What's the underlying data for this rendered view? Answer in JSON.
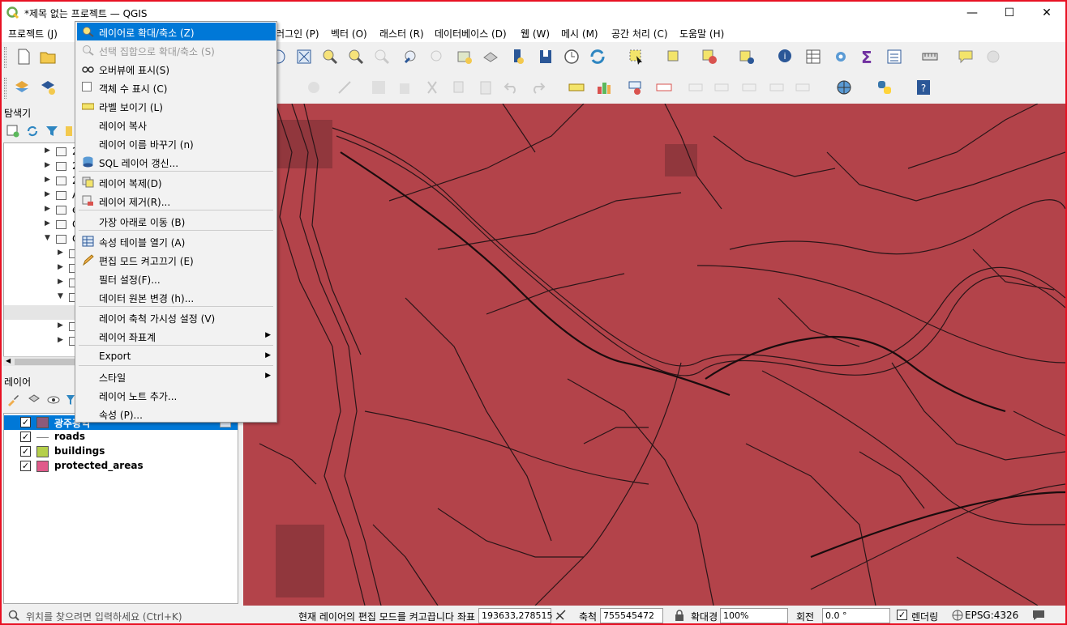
{
  "window": {
    "title": "*제목 없는 프로젝트 — QGIS",
    "minimize": "—",
    "maximize": "☐",
    "close": "✕"
  },
  "menubar": [
    {
      "label": "프로젝트 (J)"
    },
    {
      "label": "러그인 (P)"
    },
    {
      "label": "벡터 (O)"
    },
    {
      "label": "래스터 (R)"
    },
    {
      "label": "데이터베이스 (D)"
    },
    {
      "label": "웹 (W)"
    },
    {
      "label": "메시 (M)"
    },
    {
      "label": "공간 처리 (C)"
    },
    {
      "label": "도움말 (H)"
    }
  ],
  "browser_panel": {
    "title": "탐색기",
    "items": [
      {
        "label": "2"
      },
      {
        "label": "2"
      },
      {
        "label": "2"
      },
      {
        "label": "A"
      },
      {
        "label": "e"
      },
      {
        "label": "G"
      },
      {
        "label": "C"
      },
      {
        "label": ""
      },
      {
        "label": ""
      },
      {
        "label": ""
      },
      {
        "label": ""
      },
      {
        "label": ""
      },
      {
        "label": ""
      },
      {
        "label": ""
      }
    ]
  },
  "layers_panel": {
    "title": "레이어",
    "layers": [
      {
        "name": "광주광역",
        "color": "#8e5a7a",
        "checked": "✓",
        "selected": true
      },
      {
        "name": "roads",
        "color": "#888888",
        "checked": "✓",
        "line": true
      },
      {
        "name": "buildings",
        "color": "#b5cf4a",
        "checked": "✓"
      },
      {
        "name": "protected_areas",
        "color": "#e05a8a",
        "checked": "✓"
      }
    ]
  },
  "context_menu": {
    "items": [
      {
        "label": "레이어로 확대/축소 (Z)",
        "icon": "zoom-layer-icon",
        "highlighted": true
      },
      {
        "label": "선택 집합으로 확대/축소 (S)",
        "icon": "zoom-selection-icon",
        "disabled": true
      },
      {
        "label": "오버뷰에 표시(S)",
        "icon": "overview-icon"
      },
      {
        "label": "객체 수 표시 (C)",
        "icon": "checkbox-icon"
      },
      {
        "label": "라벨 보이기 (L)",
        "icon": "label-icon"
      },
      {
        "label": "레이어 복사",
        "icon": ""
      },
      {
        "label": "레이어 이름 바꾸기 (n)",
        "icon": ""
      },
      {
        "label": "SQL 레이어 갱신...",
        "icon": "database-icon"
      },
      {
        "label": "레이어 복제(D)",
        "icon": "duplicate-icon"
      },
      {
        "label": "레이어 제거(R)...",
        "icon": "remove-icon"
      },
      {
        "label": "가장 아래로 이동 (B)",
        "icon": ""
      },
      {
        "label": "속성 테이블 열기 (A)",
        "icon": "table-icon"
      },
      {
        "label": "편집 모드 켜고끄기 (E)",
        "icon": "pencil-icon"
      },
      {
        "label": "필터 설정(F)...",
        "icon": ""
      },
      {
        "label": "데이터 원본 변경 (h)...",
        "icon": ""
      },
      {
        "label": "레이어 축척 가시성 설정 (V)",
        "icon": ""
      },
      {
        "label": "레이어 좌표계",
        "icon": "",
        "submenu": true
      },
      {
        "label": "Export",
        "icon": "",
        "submenu": true
      },
      {
        "label": "스타일",
        "icon": "",
        "submenu": true
      },
      {
        "label": "레이어 노트 추가...",
        "icon": ""
      },
      {
        "label": "속성 (P)...",
        "icon": ""
      }
    ]
  },
  "statusbar": {
    "locator_placeholder": "위치를 찾으려면 입력하세요 (Ctrl+K)",
    "message": "현재 레이어의 편집 모드를 켜고끕니다",
    "coord_label": "좌표",
    "coord_value": "193633,278515",
    "scale_label": "축척",
    "scale_value": "755545472",
    "magnifier_label": "확대경",
    "magnifier_value": "100%",
    "rotation_label": "회전",
    "rotation_value": "0.0 °",
    "render_label": "렌더링",
    "crs": "EPSG:4326"
  },
  "colors": {
    "map_fill": "#b3434a",
    "highlight": "#0078d7",
    "frame": "#e81123"
  }
}
